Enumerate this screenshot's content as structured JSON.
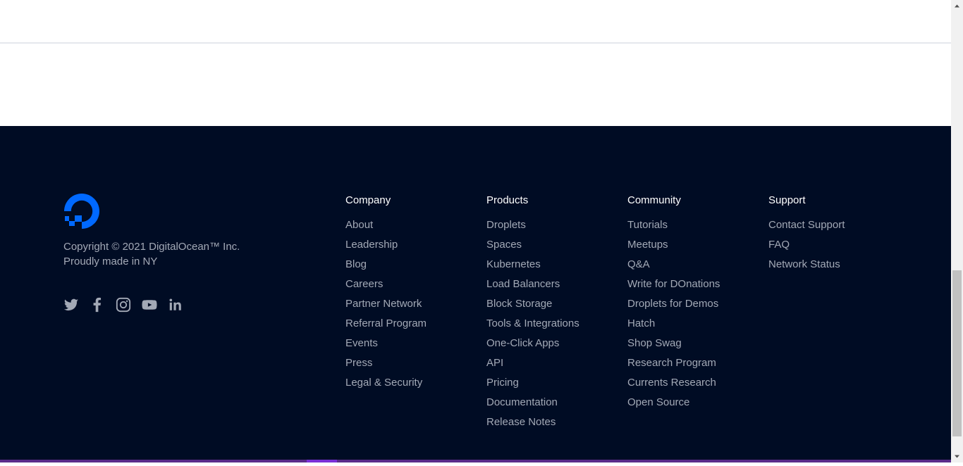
{
  "brand": {
    "logo_icon": "digitalocean-logo-icon",
    "accent_color": "#0069ff",
    "footer_bg": "#000c24"
  },
  "footer": {
    "copyright_line1": "Copyright © 2021 DigitalOcean™ Inc.",
    "copyright_line2": "Proudly made in NY",
    "social_icons": [
      "twitter-icon",
      "facebook-icon",
      "instagram-icon",
      "youtube-icon",
      "linkedin-icon"
    ],
    "columns": [
      {
        "heading": "Company",
        "links": [
          "About",
          "Leadership",
          "Blog",
          "Careers",
          "Partner Network",
          "Referral Program",
          "Events",
          "Press",
          "Legal & Security"
        ]
      },
      {
        "heading": "Products",
        "links": [
          "Droplets",
          "Spaces",
          "Kubernetes",
          "Load Balancers",
          "Block Storage",
          "Tools & Integrations",
          "One-Click Apps",
          "API",
          "Pricing",
          "Documentation",
          "Release Notes"
        ]
      },
      {
        "heading": "Community",
        "links": [
          "Tutorials",
          "Meetups",
          "Q&A",
          "Write for DOnations",
          "Droplets for Demos",
          "Hatch",
          "Shop Swag",
          "Research Program",
          "Currents Research",
          "Open Source"
        ]
      },
      {
        "heading": "Support",
        "links": [
          "Contact Support",
          "FAQ",
          "Network Status"
        ]
      }
    ]
  }
}
